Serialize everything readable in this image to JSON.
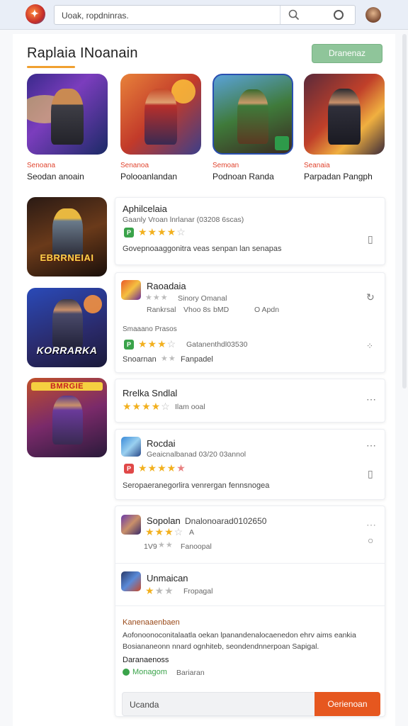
{
  "topbar": {
    "search_value": "Uoak, ropdninras.",
    "search_icon": "magnifier-icon",
    "mic_icon": "circle-icon"
  },
  "section": {
    "title": "Raplaia INoanain",
    "button_label": "Dranenaz"
  },
  "featured": [
    {
      "category": "Senoana",
      "name": "Seodan anoain"
    },
    {
      "category": "Senanoa",
      "name": "Polooanlandan"
    },
    {
      "category": "Semoan",
      "name": "Podnoan Randa"
    },
    {
      "category": "Seanaia",
      "name": "Parpadan Pangph"
    }
  ],
  "thumbs": [
    {
      "banner": "EBRRNEIAI"
    },
    {
      "banner": "KORRARKA"
    },
    {
      "banner": "BMRGIE"
    }
  ],
  "cards": {
    "c1": {
      "title": "Aphilcelaia",
      "subtitle": "Gaanly Vroan lnrlanar (03208 6scas)",
      "badge": "P",
      "desc": "Govepnoaaggonitra veas senpan lan senapas",
      "rating": 4
    },
    "c2": {
      "title": "Raoadaia",
      "line1": "Sinory Omanal",
      "line2a": "Rankrsal",
      "line2b": "Vhoo 8s",
      "line2c": "bMD",
      "line2d": "O Apdn",
      "section_label": "Smaaano Prasos",
      "meta": "Gatanenthdl03530",
      "rating": 3,
      "bottom": "Snoarnan",
      "bottom_b": "Fanpadel",
      "badge": "P"
    },
    "c3": {
      "title": "Rrelka Sndlal",
      "meta": "Ilam ooal",
      "rating": 4
    },
    "c4": {
      "title": "Rocdai",
      "subtitle": "Geaicnalbanad 03/20 03annol",
      "badge": "P",
      "desc": "Seropaeranegorlira venrergan fennsnogea",
      "rating": 4
    },
    "c5": {
      "title": "Sopolan",
      "title_b": "Dnalonoarad0102650",
      "rating": 3,
      "stars_note": "A",
      "meta_a": "1V9",
      "meta_b": "Fanoopal"
    },
    "c6": {
      "title": "Unmaican",
      "meta": "Fropagal",
      "rating": 2
    },
    "c7": {
      "heading": "Kanenaaenbaen",
      "line1": "Aofonoonoconitalaatla oekan lpanandenalocaenedon ehrv aims eankia",
      "line2": "Bosiananeonn nnard ognhiteb, seondendnnerpoan Sapigal.",
      "subheading": "Daranaenoss",
      "status": "Monagom",
      "status_b": "Bariaran"
    }
  },
  "footer": {
    "input_text": "Ucanda",
    "button_label": "Oerienoan"
  },
  "colors": {
    "accent_orange": "#e6571f",
    "accent_green": "#8fc59a",
    "star": "#f2b01e",
    "link_red": "#e0452f"
  }
}
